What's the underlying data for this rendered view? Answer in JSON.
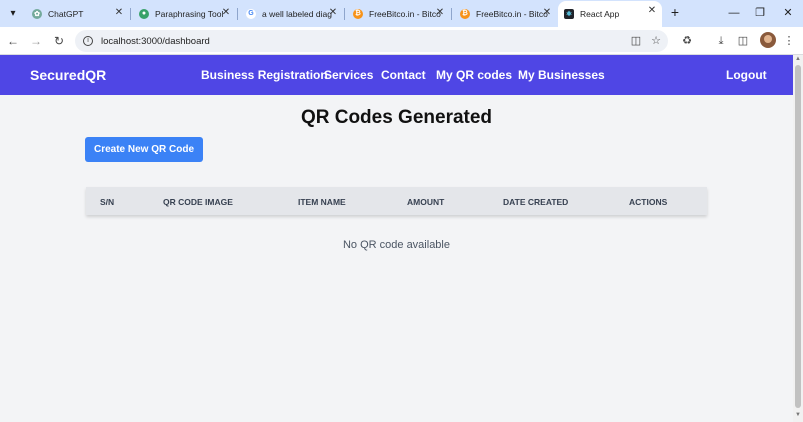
{
  "tabs": [
    {
      "title": "ChatGPT",
      "favicon": "chatgpt-icon",
      "color": "#74aa9c"
    },
    {
      "title": "Paraphrasing Tool",
      "favicon": "paraphrase-icon",
      "color": "#38a169"
    },
    {
      "title": "a well labeled diag",
      "favicon": "google-icon",
      "color": "#4285f4"
    },
    {
      "title": "FreeBitco.in - Bitco",
      "favicon": "bitcoin-icon",
      "color": "#f7931a"
    },
    {
      "title": "FreeBitco.in - Bitco",
      "favicon": "bitcoin-icon",
      "color": "#f7931a"
    },
    {
      "title": "React App",
      "favicon": "react-icon",
      "color": "#20232a"
    }
  ],
  "address_bar": {
    "url": "localhost:3000/dashboard"
  },
  "navbar": {
    "brand": "SecuredQR",
    "links": [
      "Business Registration",
      "Services",
      "Contact",
      "My QR codes",
      "My Businesses"
    ],
    "logout": "Logout"
  },
  "main": {
    "title": "QR Codes Generated",
    "create_button": "Create New QR Code",
    "columns": [
      "S/N",
      "QR CODE IMAGE",
      "ITEM NAME",
      "AMOUNT",
      "DATE CREATED",
      "ACTIONS"
    ],
    "empty_message": "No QR code available"
  },
  "colors": {
    "navbar": "#4f46e5",
    "button": "#3b82f6",
    "background": "#f3f4f6",
    "tabstrip": "#d3e3fd"
  }
}
